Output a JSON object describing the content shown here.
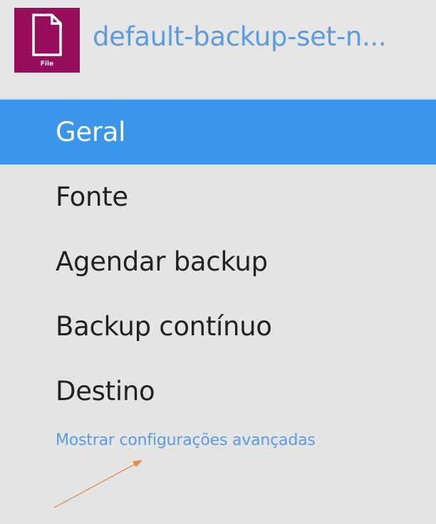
{
  "header": {
    "icon": "file-icon",
    "icon_label": "File",
    "icon_bg_color": "#990e5c",
    "title": "default-backup-set-n..."
  },
  "nav": {
    "items": [
      {
        "label": "Geral",
        "active": true
      },
      {
        "label": "Fonte",
        "active": false
      },
      {
        "label": "Agendar backup",
        "active": false
      },
      {
        "label": "Backup contínuo",
        "active": false
      },
      {
        "label": "Destino",
        "active": false
      }
    ],
    "active_color": "#3b95ea"
  },
  "advanced_link": {
    "label": "Mostrar configurações avançadas",
    "color": "#5b9be2"
  },
  "annotation": {
    "icon": "arrow-annotation",
    "color": "#f08a3c"
  }
}
